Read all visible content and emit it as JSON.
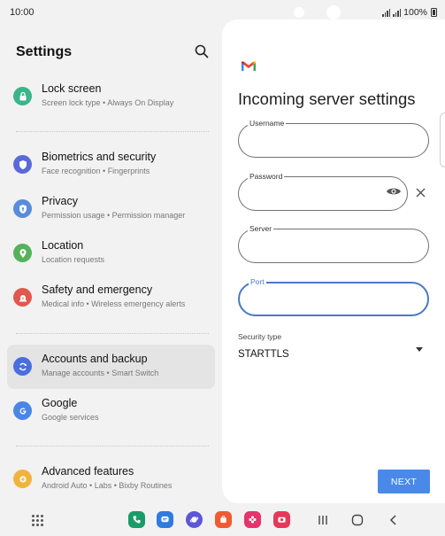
{
  "status": {
    "time": "10:00",
    "battery": "100%"
  },
  "settings": {
    "title": "Settings",
    "items": [
      {
        "label": "Lock screen",
        "sub": "Screen lock type  •  Always On Display",
        "icon": "lock-icon",
        "color": "#3bb58a"
      },
      {
        "label": "Biometrics and security",
        "sub": "Face recognition  •  Fingerprints",
        "icon": "shield-icon",
        "color": "#5a6ad6"
      },
      {
        "label": "Privacy",
        "sub": "Permission usage  •  Permission manager",
        "icon": "privacy-shield-icon",
        "color": "#5a8bdc"
      },
      {
        "label": "Location",
        "sub": "Location requests",
        "icon": "location-pin-icon",
        "color": "#55b25a"
      },
      {
        "label": "Safety and emergency",
        "sub": "Medical info  •  Wireless emergency alerts",
        "icon": "siren-icon",
        "color": "#e0584f"
      },
      {
        "label": "Accounts and backup",
        "sub": "Manage accounts  •  Smart Switch",
        "icon": "sync-icon",
        "color": "#4a6ee0"
      },
      {
        "label": "Google",
        "sub": "Google services",
        "icon": "google-icon",
        "color": "#4a86e8"
      },
      {
        "label": "Advanced features",
        "sub": "Android Auto  •  Labs  •  Bixby Routines",
        "icon": "gear-plus-icon",
        "color": "#f2b33d"
      }
    ]
  },
  "mail": {
    "heading": "Incoming server settings",
    "username_label": "Username",
    "username_value": "",
    "password_label": "Password",
    "password_value": "",
    "server_label": "Server",
    "server_value": "",
    "port_label": "Port",
    "port_value": "",
    "security_label": "Security type",
    "security_value": "STARTTLS",
    "next_label": "NEXT"
  },
  "dock": [
    {
      "name": "phone-app-icon",
      "color": "#1a9b6a"
    },
    {
      "name": "messages-app-icon",
      "color": "#2f7be0"
    },
    {
      "name": "internet-app-icon",
      "color": "#5b57d6"
    },
    {
      "name": "store-app-icon",
      "color": "#f05a34"
    },
    {
      "name": "gallery-app-icon",
      "color": "#e5356d"
    },
    {
      "name": "camera-app-icon",
      "color": "#e8385a"
    }
  ]
}
